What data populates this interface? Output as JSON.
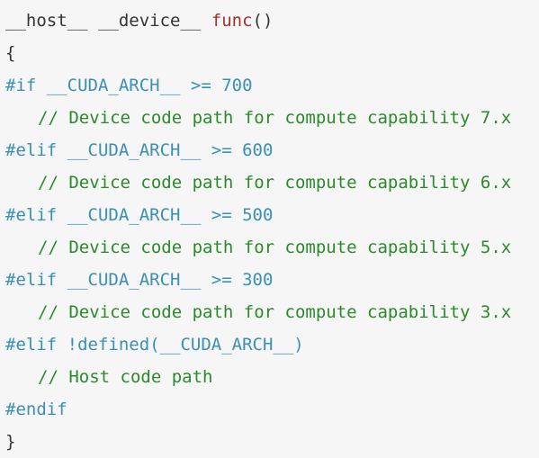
{
  "code": {
    "line_1": {
      "signature_prefix": "__host__ __device__ ",
      "function_name": "func",
      "signature_suffix": "()"
    },
    "line_2": {
      "text": "{"
    },
    "line_3": {
      "text": "#if __CUDA_ARCH__ >= 700"
    },
    "line_4": {
      "text": "// Device code path for compute capability 7.x"
    },
    "line_5": {
      "text": "#elif __CUDA_ARCH__ >= 600"
    },
    "line_6": {
      "text": "// Device code path for compute capability 6.x"
    },
    "line_7": {
      "text": "#elif __CUDA_ARCH__ >= 500"
    },
    "line_8": {
      "text": "// Device code path for compute capability 5.x"
    },
    "line_9": {
      "text": "#elif __CUDA_ARCH__ >= 300"
    },
    "line_10": {
      "text": "// Device code path for compute capability 3.x"
    },
    "line_11": {
      "text": "#elif !defined(__CUDA_ARCH__)"
    },
    "line_12": {
      "text": "// Host code path"
    },
    "line_13": {
      "text": "#endif"
    },
    "line_14": {
      "text": "}"
    }
  },
  "colors": {
    "background": "#f6f6f6",
    "plain": "#333333",
    "function_name": "#a0322c",
    "preprocessor_directive": "#3a8fb7",
    "comment": "#2a8a2a"
  }
}
